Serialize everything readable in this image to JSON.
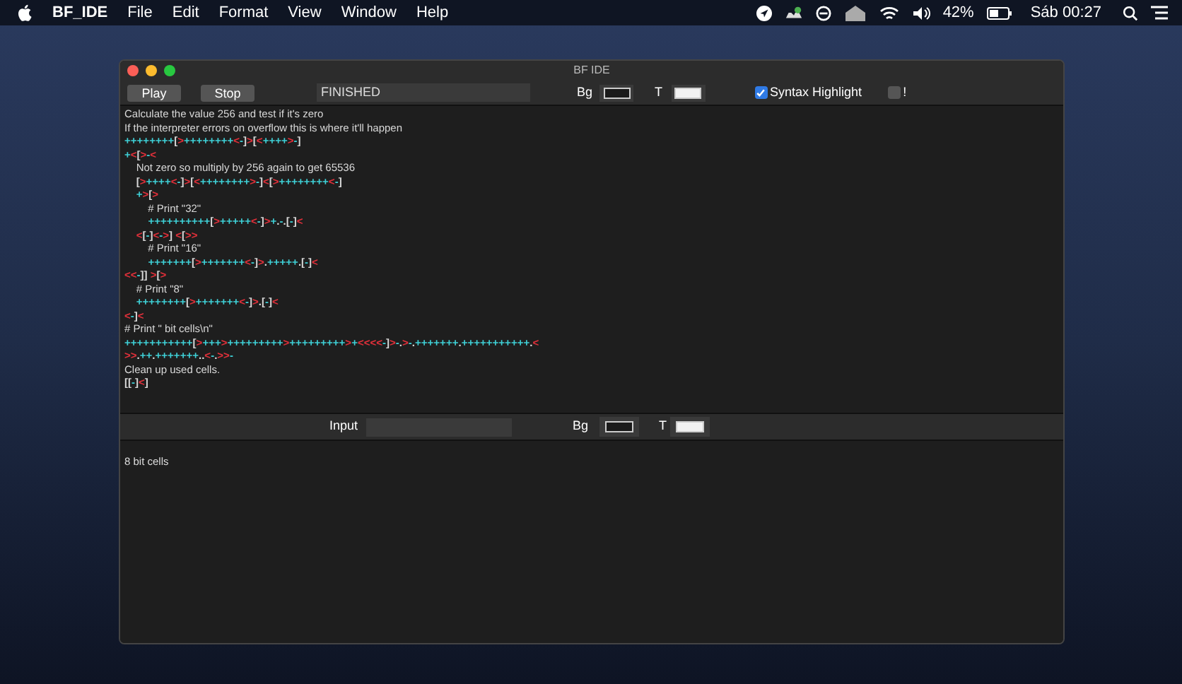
{
  "menu_bar": {
    "app_name": "BF_IDE",
    "menus": [
      "File",
      "Edit",
      "Format",
      "View",
      "Window",
      "Help"
    ],
    "battery_percent": "42%",
    "clock": "Sáb 00:27"
  },
  "window": {
    "title": "BF IDE"
  },
  "toolbar": {
    "buttons": [
      "Play",
      "Stop"
    ],
    "status": "FINISHED",
    "bg_label": "Bg",
    "text_label": "T",
    "options": [
      {
        "label": "Syntax Highlight",
        "checked": true
      },
      {
        "label": "!",
        "checked": false
      }
    ]
  },
  "editor": {
    "lines": [
      {
        "kind": "comment",
        "text": "Calculate the value 256 and test if it's zero"
      },
      {
        "kind": "comment",
        "text": "If the interpreter errors on overflow this is where it'll happen"
      },
      {
        "kind": "code",
        "text": "++++++++[>++++++++<-]>[<++++>-]"
      },
      {
        "kind": "code",
        "text": "+<[>-<"
      },
      {
        "kind": "comment",
        "text": "    Not zero so multiply by 256 again to get 65536"
      },
      {
        "kind": "code",
        "text": "    [>++++<-]>[<++++++++>-]<[>++++++++<-]"
      },
      {
        "kind": "code",
        "text": "    +>[>"
      },
      {
        "kind": "comment",
        "text": "        # Print \"32\""
      },
      {
        "kind": "code",
        "text": "        ++++++++++[>+++++<-]>+.-.[-]<"
      },
      {
        "kind": "code",
        "text": "    <[-]<->] <[>>"
      },
      {
        "kind": "comment",
        "text": "        # Print \"16\""
      },
      {
        "kind": "code",
        "text": "        +++++++[>+++++++<-]>.+++++.[-]<"
      },
      {
        "kind": "code",
        "text": "<<-]] >[>"
      },
      {
        "kind": "comment",
        "text": "    # Print \"8\""
      },
      {
        "kind": "code",
        "text": "    ++++++++[>+++++++<-]>.[-]<"
      },
      {
        "kind": "code",
        "text": "<-]<"
      },
      {
        "kind": "comment",
        "text": "# Print \" bit cells\\n\""
      },
      {
        "kind": "code",
        "text": "+++++++++++[>+++>+++++++++>+++++++++>+<<<<-]>-.>-.+++++++.+++++++++++.<"
      },
      {
        "kind": "code",
        "text": ">>.++.+++++++..<-.>>-"
      },
      {
        "kind": "comment",
        "text": "Clean up used cells."
      },
      {
        "kind": "code",
        "text": "[[-]<]"
      }
    ]
  },
  "input_bar": {
    "label": "Input",
    "bg_label": "Bg",
    "text_label": "T"
  },
  "output": {
    "text": "8 bit cells"
  }
}
